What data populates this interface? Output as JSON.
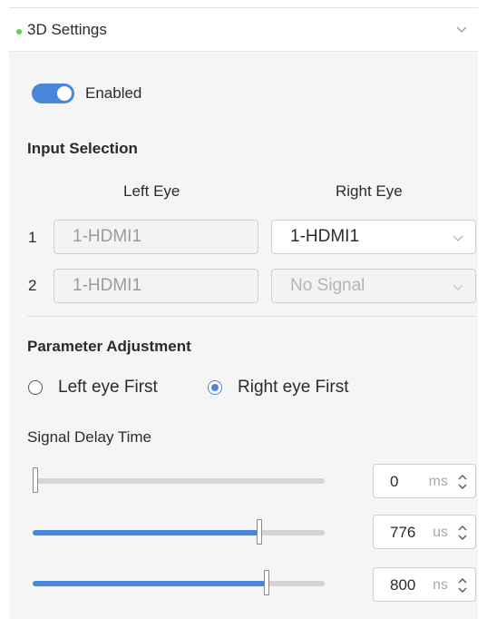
{
  "section": {
    "title": "3D Settings"
  },
  "toggle": {
    "label": "Enabled",
    "on": true
  },
  "input_selection": {
    "heading": "Input Selection",
    "left_header": "Left Eye",
    "right_header": "Right Eye",
    "rows": [
      {
        "index": "1",
        "left": "1-HDMI1",
        "right": "1-HDMI1"
      },
      {
        "index": "2",
        "left": "1-HDMI1",
        "right": "No Signal"
      }
    ]
  },
  "parameter": {
    "heading": "Parameter Adjustment",
    "radio_left": "Left eye First",
    "radio_right": "Right eye First",
    "selected": "Right eye First",
    "delay_label": "Signal Delay Time"
  },
  "delays": [
    {
      "value": "0",
      "unit": "ms",
      "level": 0.0
    },
    {
      "value": "776",
      "unit": "us",
      "level": 0.777
    },
    {
      "value": "800",
      "unit": "ns",
      "level": 0.801
    }
  ],
  "colors": {
    "accent": "#4a86dc",
    "status_dot": "#5ccf5c"
  }
}
